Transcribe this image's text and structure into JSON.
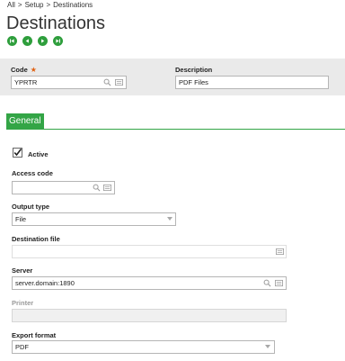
{
  "breadcrumb": {
    "items": [
      "All",
      "Setup",
      "Destinations"
    ],
    "separator": ">"
  },
  "page": {
    "title": "Destinations"
  },
  "navigation": {
    "icons": [
      "first-record-icon",
      "previous-record-icon",
      "next-record-icon",
      "last-record-icon"
    ],
    "color": "#2e9e3c"
  },
  "header": {
    "code": {
      "label": "Code",
      "value": "YPRTR",
      "required_marker": "★"
    },
    "description": {
      "label": "Description",
      "value": "PDF Files"
    }
  },
  "tabs": [
    {
      "label": "General",
      "color": "#33a546"
    }
  ],
  "general": {
    "active": {
      "label": "Active",
      "checked": true
    },
    "access_code": {
      "label": "Access code",
      "value": ""
    },
    "output_type": {
      "label": "Output type",
      "value": "File"
    },
    "destination_file": {
      "label": "Destination file",
      "value": ""
    },
    "server": {
      "label": "Server",
      "value": "server.domain:1890"
    },
    "printer": {
      "label": "Printer",
      "value": ""
    },
    "export_format": {
      "label": "Export format",
      "value": "PDF"
    }
  }
}
